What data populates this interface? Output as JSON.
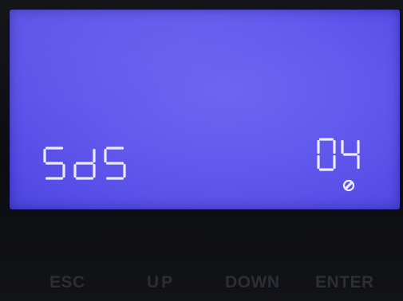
{
  "display": {
    "parameter_code": "SdS",
    "parameter_value": "04",
    "status_icon": "no-entry-icon",
    "segment_color": "#ecebff",
    "backlight_color": "#6259ee"
  },
  "buttons": {
    "esc_label": "ESC",
    "up_label": "UP",
    "down_label": "DOWN",
    "enter_label": "ENTER"
  }
}
